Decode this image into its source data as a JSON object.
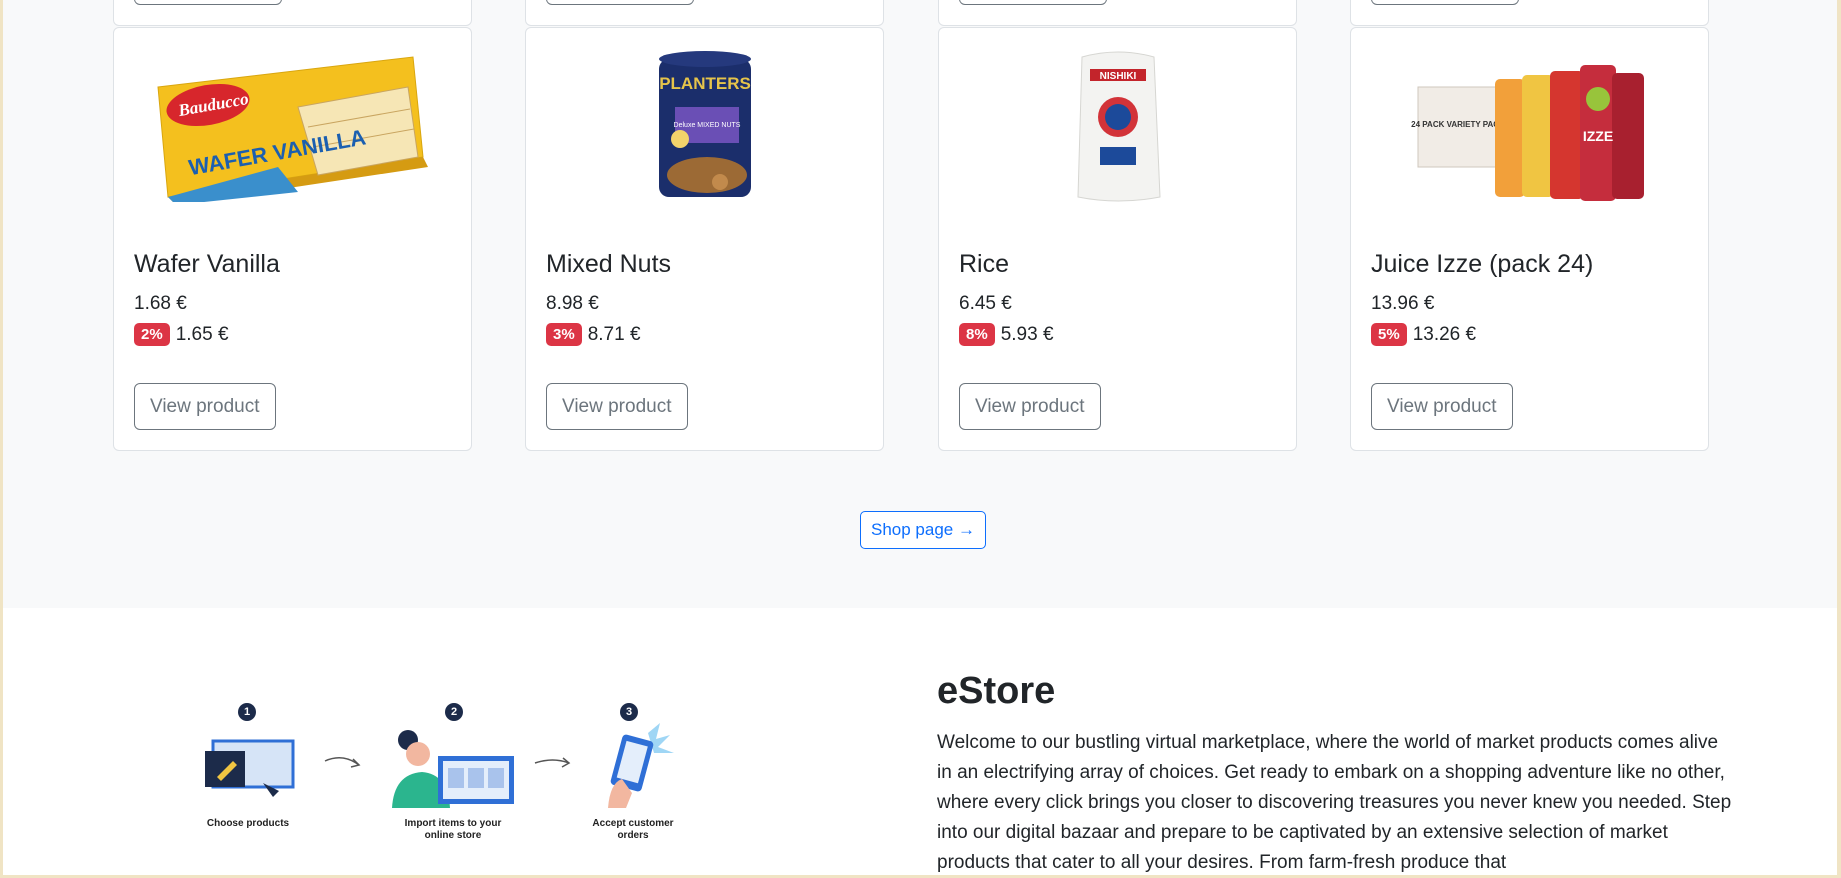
{
  "products": [
    {
      "name": "Wafer Vanilla",
      "price": "1.68 €",
      "discount": "2%",
      "sale_price": "1.65 €",
      "button": "View product",
      "image_brand": "Bauducco",
      "image_text": "WAFER VANILLA"
    },
    {
      "name": "Mixed Nuts",
      "price": "8.98 €",
      "discount": "3%",
      "sale_price": "8.71 €",
      "button": "View product",
      "image_brand": "PLANTERS",
      "image_text": "Deluxe MIXED NUTS"
    },
    {
      "name": "Rice",
      "price": "6.45 €",
      "discount": "8%",
      "sale_price": "5.93 €",
      "button": "View product",
      "image_brand": "NISHIKI",
      "image_text": ""
    },
    {
      "name": "Juice Izze (pack 24)",
      "price": "13.96 €",
      "discount": "5%",
      "sale_price": "13.26 €",
      "button": "View product",
      "image_brand": "IZZE",
      "image_text": "24 PACK VARIETY PACK"
    }
  ],
  "shop_button": "Shop page →",
  "about": {
    "title": "eStore",
    "text": "Welcome to our bustling virtual marketplace, where the world of market products comes alive in an electrifying array of choices. Get ready to embark on a shopping adventure like no other, where every click brings you closer to discovering treasures you never knew you needed. Step into our digital bazaar and prepare to be captivated by an extensive selection of market products that cater to all your desires. From farm-fresh produce that"
  },
  "steps": [
    {
      "num": "1",
      "label": "Choose products"
    },
    {
      "num": "2",
      "label": "Import items to your online store"
    },
    {
      "num": "3",
      "label": "Accept customer orders"
    }
  ],
  "colors": {
    "accent": "#0d6efd",
    "badge": "#dc3545",
    "outline": "#6c757d"
  }
}
